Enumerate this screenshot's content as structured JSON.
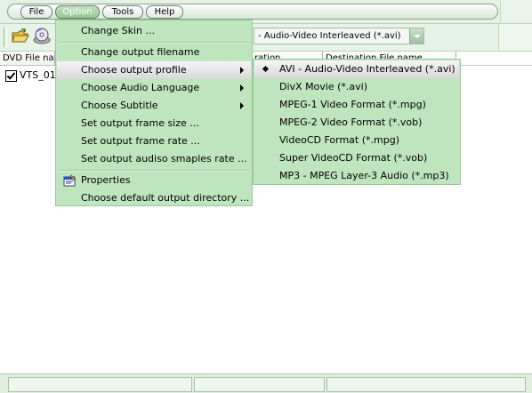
{
  "menubar": {
    "items": [
      "File",
      "Option",
      "Tools",
      "Help"
    ],
    "active_index": 1
  },
  "toolbar": {
    "open_icon": "folder-open-icon",
    "disc_icon": "disc-icon",
    "profile_value": "- Audio-Video Interleaved (*.avi)"
  },
  "list": {
    "columns": [
      "DVD File na",
      "ration",
      "Destination File name"
    ],
    "rows": [
      {
        "name": "VTS_01",
        "checked": true
      }
    ]
  },
  "option_menu": {
    "items": [
      {
        "label": "Change Skin ...",
        "submenu": false
      },
      {
        "label": "Change output filename",
        "submenu": false
      },
      {
        "label": "Choose output profile",
        "submenu": true
      },
      {
        "label": "Choose Audio Language",
        "submenu": true
      },
      {
        "label": "Choose Subtitle",
        "submenu": true
      },
      {
        "label": "Set output frame size ...",
        "submenu": false
      },
      {
        "label": "Set output frame rate ...",
        "submenu": false
      },
      {
        "label": "Set output audiso smaples rate ...",
        "submenu": false
      },
      {
        "label": "Properties",
        "submenu": false,
        "icon": "properties-icon"
      },
      {
        "label": "Choose default output directory ...",
        "submenu": false
      }
    ],
    "highlighted_index": 2
  },
  "profile_menu": {
    "items": [
      "AVI - Audio-Video Interleaved (*.avi)",
      "DivX Movie (*.avi)",
      "MPEG-1 Video Format (*.mpg)",
      "MPEG-2 Video Format (*.vob)",
      "VideoCD Format (*.mpg)",
      "Super VideoCD Format (*.vob)",
      "MP3 - MPEG Layer-3 Audio (*.mp3)"
    ],
    "selected_index": 0
  },
  "colors": {
    "menu_bg": "#bfe5bf",
    "highlight_bg": "#e6e6e6",
    "chrome_bg": "#e4f2e4"
  }
}
